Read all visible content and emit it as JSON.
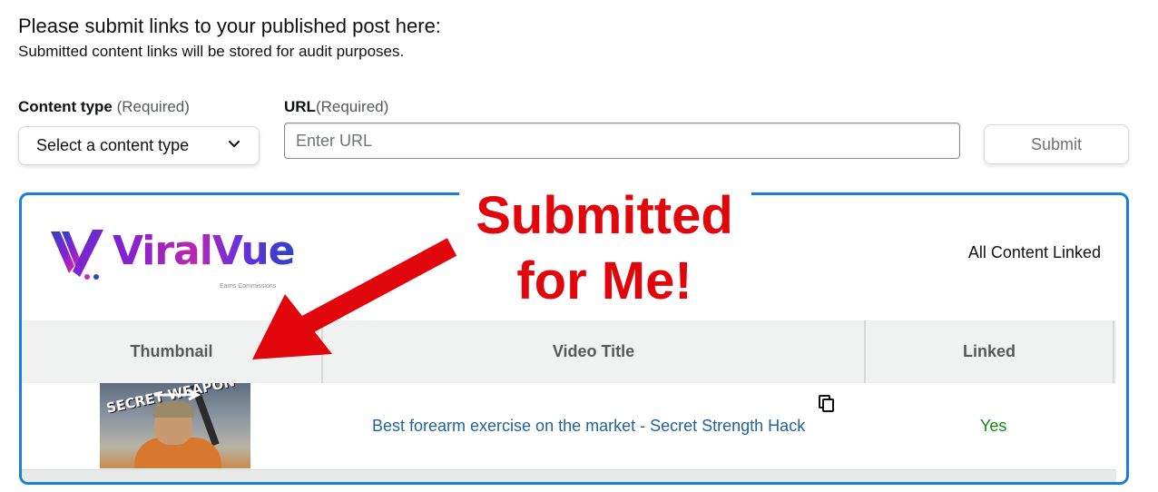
{
  "page": {
    "heading": "Please submit links to your published post here:",
    "subheading": "Submitted content links will be stored for audit purposes."
  },
  "form": {
    "content_type_label": "Content type",
    "content_type_required": " (Required)",
    "content_type_value": "Select a content type",
    "url_label": "URL",
    "url_required": "(Required)",
    "url_placeholder": "Enter URL",
    "submit_label": "Submit"
  },
  "panel": {
    "logo_text": "ViralVue",
    "logo_tagline": "Earns Commissions",
    "status": "All Content Linked",
    "border_color": "#1a7fd8",
    "table": {
      "headers": [
        "Thumbnail",
        "Video Title",
        "Linked"
      ],
      "rows": [
        {
          "thumbnail_text": "SECRET WEAPON",
          "video_title": "Best forearm exercise on the market - Secret Strength Hack",
          "linked": "Yes"
        }
      ]
    }
  },
  "annotation": {
    "line1": "Submitted",
    "line2": "for Me!",
    "color": "#e0060b"
  },
  "icons": {
    "dropdown": "chevron-down-icon",
    "copy": "copy-icon",
    "logo": "viralvue-logo-icon",
    "annotation_arrow": "arrow-icon"
  }
}
